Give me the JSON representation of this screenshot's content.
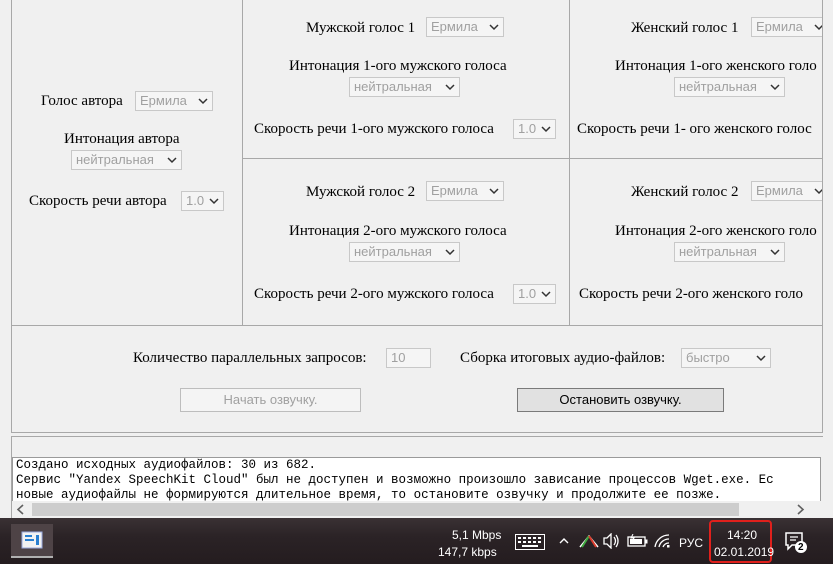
{
  "author": {
    "voice_label": "Голос автора",
    "voice_value": "Ермила",
    "intonation_label": "Интонация автора",
    "intonation_value": "нейтральная",
    "speed_label": "Скорость речи автора",
    "speed_value": "1.0"
  },
  "male1": {
    "voice_label": "Мужской голос 1",
    "voice_value": "Ермила",
    "intonation_label": "Интонация 1-ого мужского голоса",
    "intonation_value": "нейтральная",
    "speed_label": "Скорость речи 1-ого мужского голоса",
    "speed_value": "1.0"
  },
  "female1": {
    "voice_label": "Женский голос 1",
    "voice_value": "Ермила",
    "intonation_label": "Интонация 1-ого женского голо",
    "intonation_value": "нейтральная",
    "speed_label": "Скорость речи 1- ого женского голос"
  },
  "male2": {
    "voice_label": "Мужской голос 2",
    "voice_value": "Ермила",
    "intonation_label": "Интонация 2-ого мужского голоса",
    "intonation_value": "нейтральная",
    "speed_label": "Скорость речи 2-ого мужского голоса",
    "speed_value": "1.0"
  },
  "female2": {
    "voice_label": "Женский голос 2",
    "voice_value": "Ермила",
    "intonation_label": "Интонация 2-ого женского голо",
    "intonation_value": "нейтральная",
    "speed_label": "Скорость речи 2-ого женского голо"
  },
  "controls": {
    "parallel_label": "Количество параллельных запросов:",
    "parallel_value": "10",
    "assembly_label": "Сборка итоговых аудио-файлов:",
    "assembly_value": "быстро",
    "start_button": "Начать озвучку.",
    "stop_button": "Остановить озвучку."
  },
  "log": {
    "lines": [
      "Создано исходных аудиофайлов: 30 из 682.",
      "Сервис \"Yandex SpeechKit Cloud\" был не доступен и возможно произошло зависание процессов Wget.exe. Ес",
      "новые аудиофайлы не формируются длительное время, то остановите озвучку и продолжите ее позже."
    ]
  },
  "taskbar": {
    "net_up": "5,1 Mbps",
    "net_down": "147,7 kbps",
    "language": "РУС",
    "time": "14:20",
    "date": "02.01.2019",
    "notification_count": "2",
    "highlight_color": "#e0201c",
    "icons": [
      "app-icon",
      "keyboard-icon",
      "chevron-up-icon",
      "warning-icon",
      "volume-icon",
      "battery-icon",
      "wifi-icon",
      "notification-icon"
    ]
  }
}
